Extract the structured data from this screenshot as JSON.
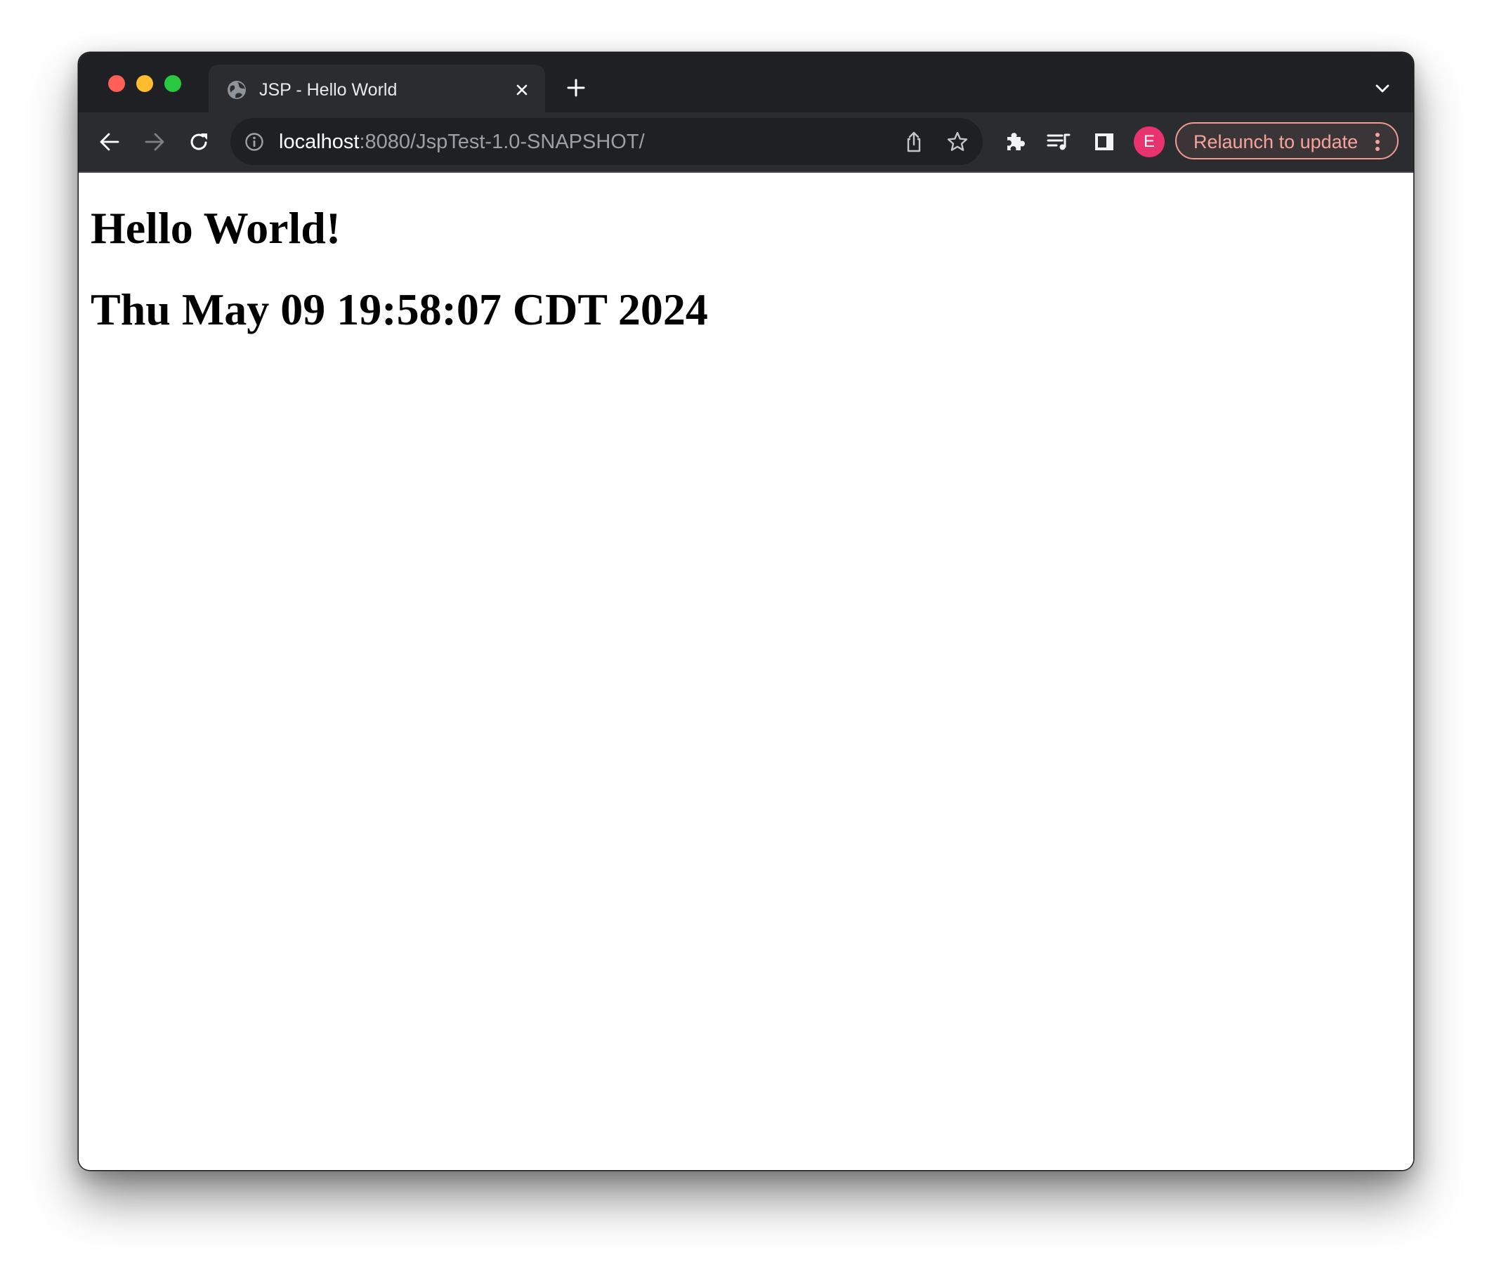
{
  "window": {
    "traffic_lights": [
      "close",
      "minimize",
      "zoom"
    ]
  },
  "tabs": [
    {
      "title": "JSP - Hello World",
      "icon": "globe-icon",
      "active": true
    }
  ],
  "tabstrip": {
    "new_tab_icon": "plus-icon",
    "tab_search_icon": "chevron-down-icon"
  },
  "toolbar": {
    "back_icon": "arrow-left-icon",
    "forward_icon": "arrow-right-icon",
    "forward_enabled": false,
    "reload_icon": "reload-icon",
    "omnibox": {
      "host": "localhost",
      "path": ":8080/JspTest-1.0-SNAPSHOT/",
      "security_icon": "info-icon",
      "share_icon": "share-icon",
      "bookmark_icon": "star-icon"
    },
    "extensions_icon": "puzzle-icon",
    "media_icon": "media-queue-icon",
    "side_panel_icon": "side-panel-icon",
    "profile_initial": "E",
    "profile_color": "#e8336e",
    "relaunch_label": "Relaunch to update",
    "relaunch_color": "#f6a49b",
    "menu_icon": "kebab-menu-icon"
  },
  "page": {
    "heading": "Hello World!",
    "datetime": "Thu May 09 19:58:07 CDT 2024"
  }
}
